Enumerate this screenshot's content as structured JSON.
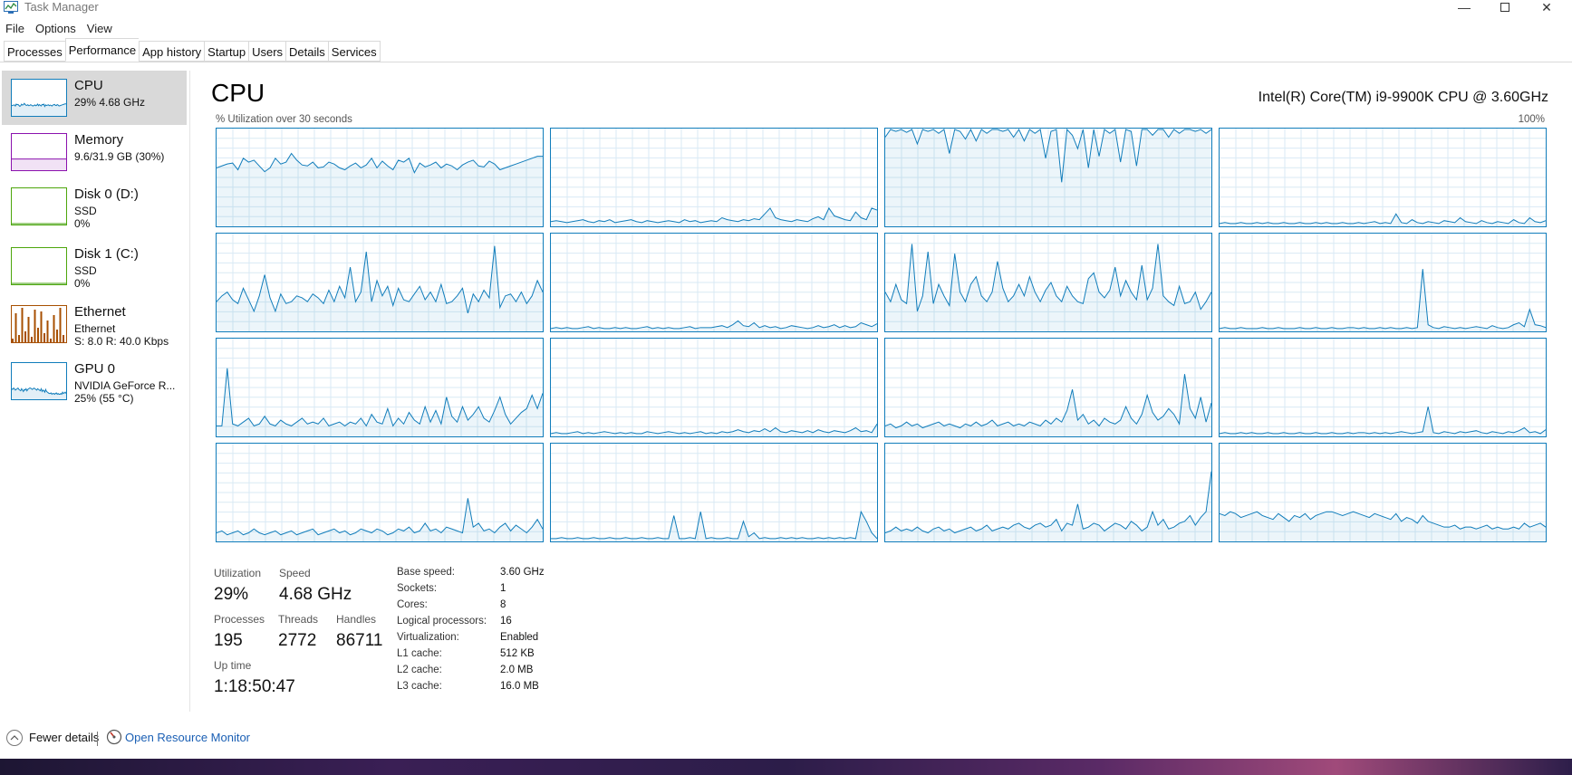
{
  "window": {
    "title": "Task Manager"
  },
  "menu": [
    "File",
    "Options",
    "View"
  ],
  "tabs": [
    "Processes",
    "Performance",
    "App history",
    "Startup",
    "Users",
    "Details",
    "Services"
  ],
  "active_tab": "Performance",
  "sidebar": [
    {
      "title": "CPU",
      "sub1": "29% 4.68 GHz",
      "sub2": "",
      "color": "#117dbb",
      "selected": true
    },
    {
      "title": "Memory",
      "sub1": "9.6/31.9 GB (30%)",
      "sub2": "",
      "color": "#8b12ae",
      "selected": false
    },
    {
      "title": "Disk 0 (D:)",
      "sub1": "SSD",
      "sub2": "0%",
      "color": "#4da60c",
      "selected": false
    },
    {
      "title": "Disk 1 (C:)",
      "sub1": "SSD",
      "sub2": "0%",
      "color": "#4da60c",
      "selected": false
    },
    {
      "title": "Ethernet",
      "sub1": "Ethernet",
      "sub2": "S: 8.0  R: 40.0 Kbps",
      "color": "#a74f01",
      "selected": false
    },
    {
      "title": "GPU 0",
      "sub1": "NVIDIA GeForce R...",
      "sub2": "25%  (55 °C)",
      "color": "#117dbb",
      "selected": false
    }
  ],
  "main": {
    "title": "CPU",
    "cpu_model": "Intel(R) Core(TM) i9-9900K CPU @ 3.60GHz",
    "graph_caption": "% Utilization over 30 seconds",
    "graph_max": "100%",
    "graph_color": "#117dbb",
    "cores": [
      [
        60,
        62,
        64,
        65,
        58,
        70,
        66,
        68,
        62,
        56,
        60,
        70,
        64,
        66,
        75,
        68,
        63,
        62,
        66,
        60,
        61,
        66,
        64,
        60,
        58,
        62,
        65,
        60,
        63,
        70,
        60,
        67,
        62,
        58,
        68,
        66,
        70,
        55,
        65,
        61,
        63,
        66,
        60,
        64,
        62,
        58,
        63,
        66,
        68,
        62,
        61,
        67,
        64,
        58,
        60,
        62,
        64,
        66,
        68,
        70,
        72,
        72
      ],
      [
        4,
        5,
        4,
        3,
        4,
        5,
        6,
        4,
        3,
        5,
        4,
        6,
        3,
        4,
        5,
        6,
        4,
        3,
        5,
        4,
        3,
        4,
        5,
        4,
        3,
        6,
        4,
        5,
        3,
        4,
        5,
        4,
        8,
        6,
        5,
        4,
        6,
        5,
        7,
        6,
        12,
        18,
        8,
        6,
        5,
        4,
        6,
        5,
        4,
        7,
        9,
        6,
        18,
        10,
        8,
        6,
        5,
        14,
        8,
        6,
        18,
        16
      ],
      [
        92,
        100,
        98,
        100,
        97,
        100,
        85,
        100,
        98,
        100,
        96,
        100,
        75,
        100,
        98,
        90,
        100,
        88,
        100,
        96,
        100,
        100,
        98,
        100,
        92,
        100,
        88,
        100,
        96,
        100,
        70,
        98,
        100,
        45,
        100,
        94,
        80,
        100,
        60,
        100,
        72,
        100,
        96,
        100,
        66,
        100,
        98,
        62,
        100,
        100,
        94,
        100,
        100,
        92,
        100,
        96,
        100,
        100,
        98,
        100,
        96,
        100
      ],
      [
        2,
        3,
        2,
        2,
        3,
        2,
        2,
        3,
        2,
        3,
        2,
        2,
        3,
        2,
        2,
        3,
        2,
        2,
        3,
        2,
        3,
        2,
        2,
        3,
        2,
        2,
        3,
        2,
        3,
        4,
        2,
        3,
        2,
        12,
        3,
        2,
        6,
        3,
        2,
        4,
        3,
        2,
        5,
        4,
        3,
        8,
        4,
        3,
        2,
        5,
        3,
        2,
        4,
        3,
        2,
        6,
        3,
        2,
        8,
        4,
        3,
        5
      ],
      [
        30,
        36,
        40,
        32,
        28,
        44,
        32,
        20,
        36,
        58,
        34,
        20,
        38,
        28,
        30,
        36,
        34,
        30,
        38,
        34,
        28,
        42,
        30,
        46,
        34,
        66,
        30,
        40,
        82,
        30,
        52,
        36,
        46,
        26,
        44,
        32,
        30,
        38,
        46,
        32,
        40,
        30,
        48,
        28,
        30,
        36,
        44,
        18,
        38,
        30,
        42,
        34,
        88,
        24,
        36,
        38,
        30,
        40,
        28,
        36,
        52,
        40
      ],
      [
        2,
        3,
        2,
        3,
        2,
        2,
        3,
        4,
        2,
        3,
        2,
        2,
        3,
        2,
        3,
        2,
        2,
        3,
        4,
        2,
        3,
        2,
        3,
        2,
        2,
        3,
        4,
        2,
        3,
        3,
        3,
        4,
        5,
        3,
        6,
        10,
        5,
        4,
        8,
        3,
        5,
        3,
        4,
        2,
        3,
        5,
        4,
        3,
        2,
        3,
        5,
        3,
        4,
        6,
        3,
        5,
        3,
        4,
        8,
        6,
        4,
        7
      ],
      [
        40,
        30,
        48,
        32,
        28,
        90,
        20,
        36,
        82,
        28,
        48,
        36,
        26,
        80,
        40,
        30,
        48,
        56,
        36,
        30,
        40,
        72,
        44,
        30,
        36,
        48,
        36,
        56,
        40,
        30,
        42,
        50,
        36,
        30,
        46,
        36,
        30,
        28,
        54,
        60,
        40,
        34,
        42,
        66,
        36,
        52,
        40,
        32,
        68,
        32,
        44,
        90,
        36,
        30,
        26,
        46,
        28,
        30,
        40,
        22,
        30,
        40
      ],
      [
        2,
        3,
        2,
        2,
        3,
        2,
        2,
        2,
        3,
        2,
        2,
        3,
        2,
        2,
        2,
        3,
        2,
        2,
        3,
        2,
        2,
        3,
        2,
        2,
        3,
        3,
        2,
        3,
        2,
        2,
        3,
        2,
        3,
        2,
        2,
        3,
        2,
        3,
        64,
        6,
        3,
        2,
        4,
        3,
        2,
        3,
        2,
        3,
        4,
        3,
        2,
        5,
        3,
        2,
        3,
        6,
        8,
        4,
        22,
        6,
        5,
        3
      ],
      [
        10,
        10,
        70,
        12,
        10,
        14,
        18,
        10,
        12,
        20,
        12,
        10,
        16,
        12,
        10,
        14,
        18,
        12,
        14,
        12,
        18,
        10,
        12,
        14,
        10,
        14,
        12,
        18,
        10,
        22,
        14,
        12,
        28,
        10,
        18,
        12,
        24,
        16,
        12,
        30,
        14,
        26,
        12,
        40,
        20,
        14,
        30,
        16,
        22,
        30,
        18,
        14,
        26,
        40,
        22,
        12,
        18,
        24,
        28,
        42,
        28,
        44
      ],
      [
        2,
        3,
        2,
        2,
        3,
        4,
        2,
        3,
        2,
        3,
        4,
        3,
        2,
        3,
        2,
        3,
        2,
        2,
        4,
        3,
        2,
        3,
        4,
        3,
        2,
        3,
        2,
        3,
        4,
        2,
        3,
        2,
        4,
        3,
        4,
        6,
        4,
        3,
        5,
        4,
        7,
        4,
        8,
        4,
        3,
        5,
        4,
        3,
        5,
        3,
        6,
        4,
        3,
        5,
        4,
        3,
        5,
        8,
        4,
        5,
        3,
        12
      ],
      [
        10,
        12,
        8,
        10,
        14,
        10,
        12,
        8,
        10,
        12,
        14,
        10,
        12,
        10,
        8,
        12,
        10,
        14,
        10,
        12,
        16,
        10,
        12,
        14,
        10,
        12,
        10,
        14,
        12,
        10,
        16,
        12,
        18,
        14,
        26,
        48,
        16,
        22,
        12,
        16,
        10,
        18,
        14,
        12,
        16,
        30,
        18,
        12,
        22,
        42,
        24,
        16,
        20,
        28,
        22,
        12,
        64,
        28,
        18,
        40,
        14,
        34
      ],
      [
        2,
        3,
        2,
        2,
        3,
        2,
        3,
        2,
        2,
        3,
        2,
        2,
        3,
        2,
        2,
        3,
        2,
        2,
        3,
        2,
        2,
        3,
        2,
        2,
        3,
        2,
        3,
        3,
        2,
        3,
        2,
        3,
        2,
        3,
        4,
        3,
        2,
        3,
        4,
        30,
        3,
        2,
        4,
        3,
        2,
        4,
        3,
        4,
        5,
        3,
        2,
        4,
        3,
        2,
        4,
        3,
        5,
        8,
        3,
        4,
        2,
        6
      ],
      [
        8,
        10,
        6,
        8,
        10,
        6,
        8,
        12,
        8,
        6,
        8,
        10,
        6,
        8,
        10,
        6,
        8,
        10,
        12,
        6,
        8,
        10,
        12,
        8,
        10,
        6,
        8,
        12,
        10,
        8,
        12,
        10,
        6,
        8,
        12,
        10,
        14,
        8,
        10,
        18,
        10,
        12,
        8,
        14,
        12,
        10,
        8,
        44,
        14,
        18,
        10,
        12,
        8,
        14,
        18,
        10,
        16,
        12,
        8,
        14,
        22,
        12
      ],
      [
        2,
        2,
        3,
        2,
        2,
        3,
        2,
        2,
        3,
        2,
        2,
        3,
        2,
        2,
        3,
        2,
        2,
        3,
        2,
        2,
        3,
        2,
        2,
        26,
        2,
        2,
        3,
        2,
        30,
        2,
        3,
        2,
        2,
        3,
        2,
        2,
        20,
        4,
        8,
        2,
        3,
        2,
        2,
        3,
        2,
        3,
        2,
        3,
        2,
        2,
        3,
        2,
        3,
        2,
        3,
        2,
        3,
        2,
        30,
        20,
        8,
        2
      ],
      [
        8,
        10,
        14,
        10,
        12,
        10,
        14,
        10,
        8,
        12,
        14,
        10,
        12,
        8,
        10,
        12,
        14,
        10,
        12,
        16,
        10,
        12,
        14,
        12,
        16,
        18,
        14,
        12,
        16,
        18,
        14,
        16,
        22,
        10,
        18,
        16,
        38,
        12,
        14,
        18,
        16,
        10,
        14,
        18,
        16,
        12,
        20,
        16,
        10,
        14,
        30,
        16,
        22,
        12,
        14,
        18,
        20,
        26,
        16,
        24,
        30,
        72
      ],
      [
        28,
        26,
        30,
        28,
        24,
        26,
        28,
        30,
        26,
        24,
        22,
        28,
        24,
        20,
        26,
        24,
        28,
        22,
        26,
        28,
        30,
        30,
        28,
        26,
        28,
        30,
        28,
        26,
        24,
        28,
        26,
        24,
        22,
        28,
        20,
        24,
        22,
        18,
        26,
        20,
        18,
        16,
        14,
        14,
        16,
        12,
        14,
        14,
        12,
        14,
        16,
        12,
        14,
        12,
        12,
        14,
        12,
        18,
        14,
        16,
        18,
        14
      ]
    ]
  },
  "stats": {
    "utilization_label": "Utilization",
    "utilization": "29%",
    "speed_label": "Speed",
    "speed": "4.68 GHz",
    "processes_label": "Processes",
    "processes": "195",
    "threads_label": "Threads",
    "threads": "2772",
    "handles_label": "Handles",
    "handles": "86711",
    "uptime_label": "Up time",
    "uptime": "1:18:50:47"
  },
  "specs": [
    {
      "label": "Base speed:",
      "value": "3.60 GHz"
    },
    {
      "label": "Sockets:",
      "value": "1"
    },
    {
      "label": "Cores:",
      "value": "8"
    },
    {
      "label": "Logical processors:",
      "value": "16"
    },
    {
      "label": "Virtualization:",
      "value": "Enabled"
    },
    {
      "label": "L1 cache:",
      "value": "512 KB"
    },
    {
      "label": "L2 cache:",
      "value": "2.0 MB"
    },
    {
      "label": "L3 cache:",
      "value": "16.0 MB"
    }
  ],
  "footer": {
    "fewer_details": "Fewer details",
    "open_resource_monitor": "Open Resource Monitor"
  }
}
